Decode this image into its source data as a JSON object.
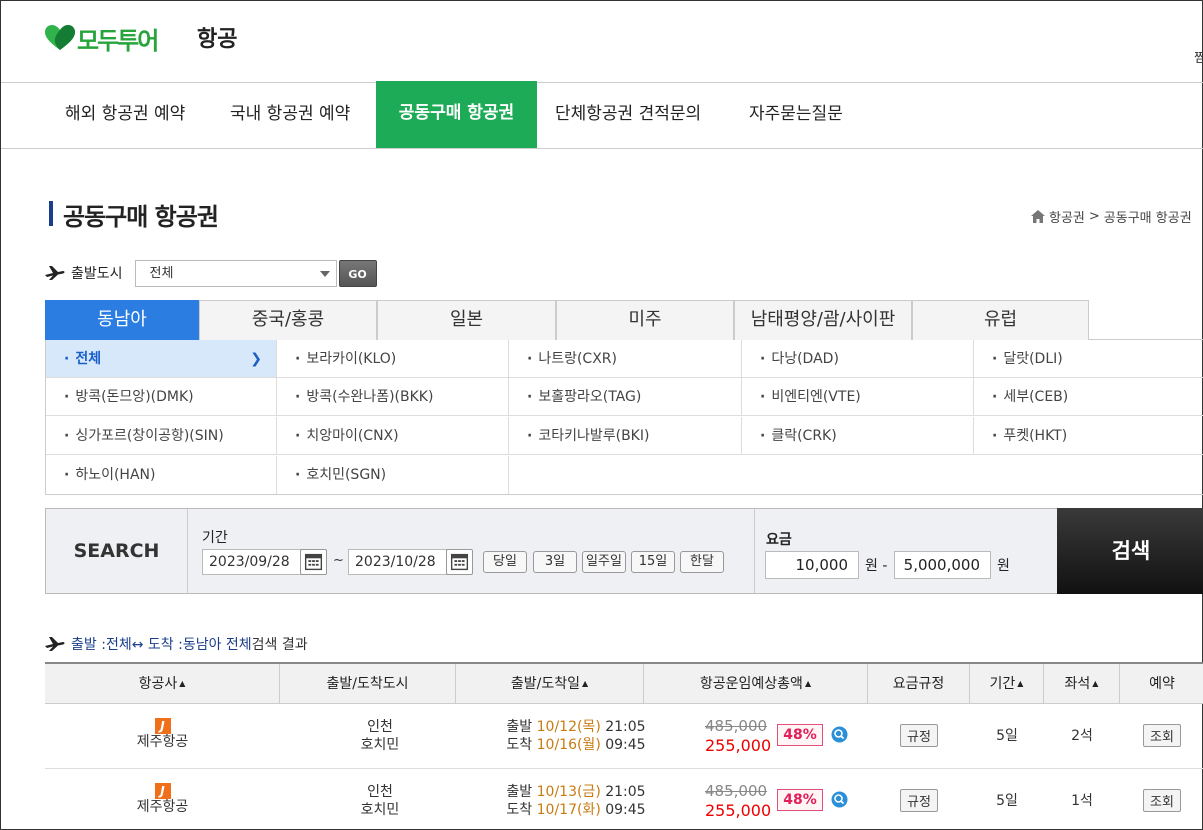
{
  "header": {
    "brand": "모두투어",
    "title": "항공",
    "edge_text": "찜"
  },
  "nav": [
    {
      "label": "해외 항공권 예약"
    },
    {
      "label": "국내 항공권 예약"
    },
    {
      "label": "공동구매 항공권",
      "active": true
    },
    {
      "label": "단체항공권 견적문의"
    },
    {
      "label": "자주묻는질문"
    }
  ],
  "page_title": "공동구매 항공권",
  "breadcrumb": {
    "item1": "항공권",
    "separator": ">",
    "item2": "공동구매 항공권"
  },
  "departure": {
    "label": "출발도시",
    "selected": "전체",
    "go_label": "GO"
  },
  "region_tabs": [
    "동남아",
    "중국/홍콩",
    "일본",
    "미주",
    "남태평양/괌/사이판",
    "유럽"
  ],
  "cities": [
    "전체",
    "보라카이(KLO)",
    "나트랑(CXR)",
    "다낭(DAD)",
    "달랏(DLI)",
    "방콕(돈므앙)(DMK)",
    "방콕(수완나폼)(BKK)",
    "보홀팡라오(TAG)",
    "비엔티엔(VTE)",
    "세부(CEB)",
    "싱가포르(창이공항)(SIN)",
    "치앙마이(CNX)",
    "코타키나발루(BKI)",
    "클락(CRK)",
    "푸켓(HKT)",
    "하노이(HAN)",
    "호치민(SGN)"
  ],
  "search": {
    "label": "SEARCH",
    "period_label": "기간",
    "date_from": "2023/09/28",
    "date_sep": "~",
    "date_to": "2023/10/28",
    "quick": [
      "당일",
      "3일",
      "일주일",
      "15일",
      "한달"
    ],
    "fare_label": "요금",
    "fare_min": "10,000",
    "fare_min_unit": "원 -",
    "fare_max": "5,000,000",
    "fare_max_unit": "원",
    "button": "검색"
  },
  "summary": {
    "prefix": "출발 : ",
    "dep": "전체",
    "arrow": " ↔ 도착 : ",
    "arr": "동남아 전체",
    "suffix": " 검색 결과"
  },
  "table": {
    "headers": [
      "항공사",
      "출발/도착도시",
      "출발/도착일",
      "항공운임예상총액",
      "요금규정",
      "기간",
      "좌석",
      "예약"
    ],
    "rows": [
      {
        "airline": "제주항공",
        "logo": "J",
        "dep_city": "인천",
        "arr_city": "호치민",
        "dep_prefix": "출발",
        "dep_date": "10/12(목)",
        "dep_time": "21:05",
        "arr_prefix": "도착",
        "arr_date": "10/16(월)",
        "arr_time": "09:45",
        "orig_price": "485,000",
        "sale_price": "255,000",
        "discount": "48%",
        "rule": "규정",
        "duration": "5일",
        "seats": "2석",
        "action": "조회"
      },
      {
        "airline": "제주항공",
        "logo": "J",
        "dep_city": "인천",
        "arr_city": "호치민",
        "dep_prefix": "출발",
        "dep_date": "10/13(금)",
        "dep_time": "21:05",
        "arr_prefix": "도착",
        "arr_date": "10/17(화)",
        "arr_time": "09:45",
        "orig_price": "485,000",
        "sale_price": "255,000",
        "discount": "48%",
        "rule": "규정",
        "duration": "5일",
        "seats": "1석",
        "action": "조회"
      }
    ]
  },
  "colors": {
    "accent_green": "#1eab57",
    "tab_blue": "#2b7de1",
    "price_red": "#e00000",
    "date_orange": "#c87b12"
  }
}
